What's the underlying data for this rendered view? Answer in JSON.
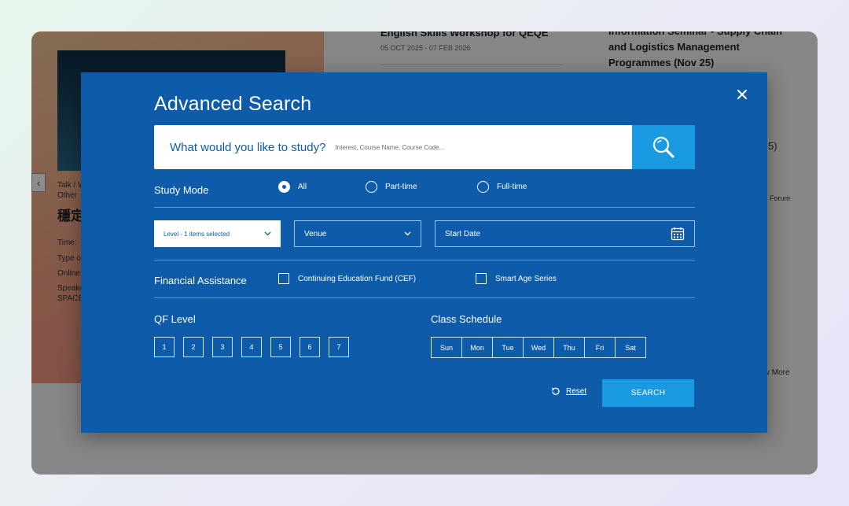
{
  "background": {
    "left_card": {
      "category": "Talk / W",
      "category2": "Other",
      "title": "穩定",
      "time_label": "Time:",
      "type_label": "Type o",
      "online_label": "Online",
      "speaker_label": "Speake",
      "space_label": "SPACE"
    },
    "middle": {
      "title": "English Skills Workshop for QEQE",
      "date": "05 OCT 2025 - 07 FEB 2026"
    },
    "right": {
      "title": "Information Seminar - Supply Chain and Logistics Management Programmes (Nov 25)",
      "side_digit": "5)",
      "forum": "Forum",
      "more": "v More"
    }
  },
  "modal": {
    "title": "Advanced Search",
    "search": {
      "prompt": "What would you like to study?",
      "placeholder": "Interest, Course Name, Course Code..."
    },
    "study_mode": {
      "label": "Study Mode",
      "options": [
        "All",
        "Part-time",
        "Full-time"
      ],
      "selected": "All"
    },
    "filters": {
      "level": "Level - 1 items selected",
      "venue": "Venue",
      "start_date": "Start Date"
    },
    "financial": {
      "label": "Financial Assistance",
      "options": [
        "Continuing Education Fund (CEF)",
        "Smart Age Series"
      ]
    },
    "qf_level": {
      "label": "QF Level",
      "levels": [
        "1",
        "2",
        "3",
        "4",
        "5",
        "6",
        "7"
      ]
    },
    "class_schedule": {
      "label": "Class Schedule",
      "days": [
        "Sun",
        "Mon",
        "Tue",
        "Wed",
        "Thu",
        "Fri",
        "Sat"
      ]
    },
    "reset_label": "Reset",
    "search_label": "SEARCH"
  },
  "colors": {
    "modal_bg": "#0d5ba9",
    "accent": "#1a9ae0"
  },
  "icons": [
    "close-icon",
    "search-icon",
    "chevron-down-icon",
    "calendar-icon",
    "reset-icon"
  ]
}
